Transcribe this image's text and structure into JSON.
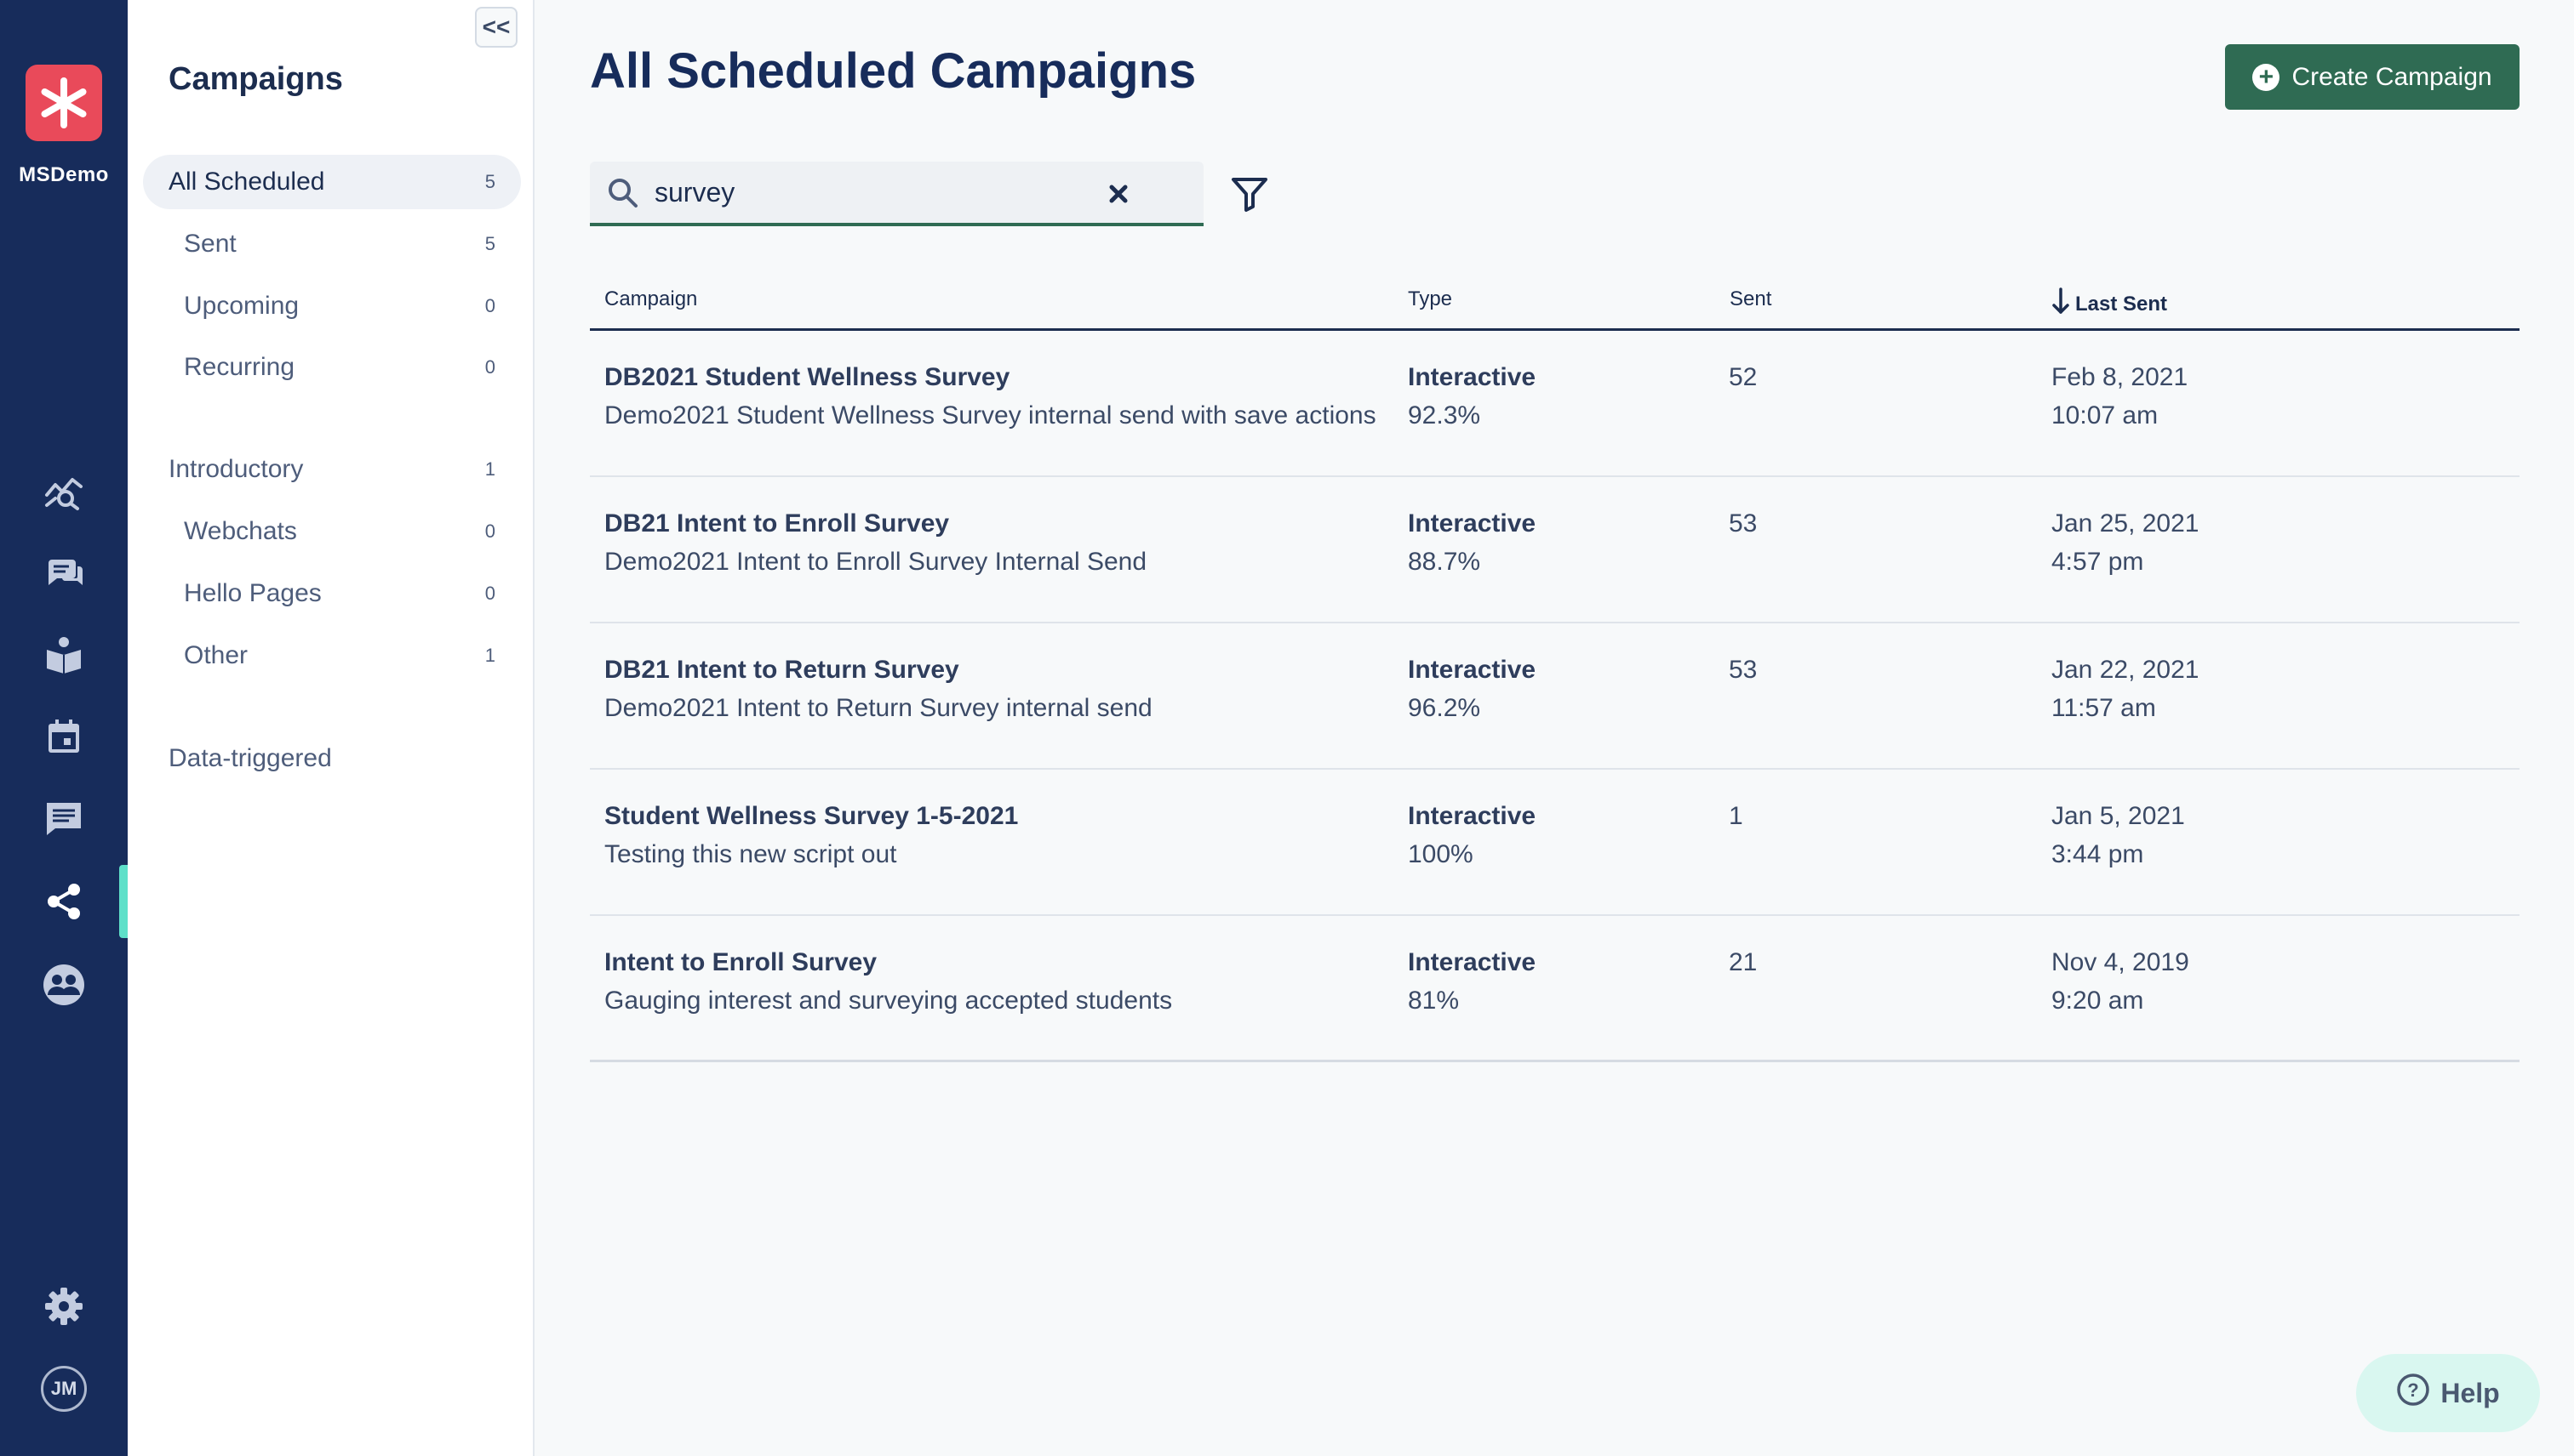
{
  "org": {
    "name": "MSDemo",
    "avatar_initials": "JM"
  },
  "rail": {
    "icons": [
      "analytics-icon",
      "chat-bubbles-icon",
      "book-icon",
      "calendar-icon",
      "message-icon",
      "share-network-icon",
      "people-icon",
      "gear-icon"
    ],
    "active": "share-network-icon",
    "active_color": "#5ee0c9"
  },
  "sidebar": {
    "title": "Campaigns",
    "collapse_label": "<<",
    "groups": [
      {
        "label": "All Scheduled",
        "count": "5"
      },
      {
        "label": "Sent",
        "count": "5"
      },
      {
        "label": "Upcoming",
        "count": "0"
      },
      {
        "label": "Recurring",
        "count": "0"
      },
      {
        "label": "Introductory",
        "count": "1"
      },
      {
        "label": "Webchats",
        "count": "0"
      },
      {
        "label": "Hello Pages",
        "count": "0"
      },
      {
        "label": "Other",
        "count": "1"
      },
      {
        "label": "Data-triggered",
        "count": ""
      }
    ]
  },
  "main": {
    "title": "All Scheduled Campaigns",
    "create_button": "Create Campaign",
    "search": {
      "value": "survey",
      "placeholder": ""
    },
    "columns": [
      "Campaign",
      "Type",
      "Sent",
      "Last Sent"
    ],
    "sort_column": "Last Sent",
    "rows": [
      {
        "name": "DB2021 Student Wellness Survey",
        "description": "Demo2021 Student Wellness Survey internal send with save actions",
        "type": "Interactive",
        "rate": "92.3%",
        "sent": "52",
        "date": "Feb 8, 2021",
        "time": "10:07 am"
      },
      {
        "name": "DB21 Intent to Enroll Survey",
        "description": "Demo2021 Intent to Enroll Survey Internal Send",
        "type": "Interactive",
        "rate": "88.7%",
        "sent": "53",
        "date": "Jan 25, 2021",
        "time": "4:57 pm"
      },
      {
        "name": "DB21 Intent to Return Survey",
        "description": "Demo2021 Intent to Return Survey internal send",
        "type": "Interactive",
        "rate": "96.2%",
        "sent": "53",
        "date": "Jan 22, 2021",
        "time": "11:57 am"
      },
      {
        "name": "Student Wellness Survey 1-5-2021",
        "description": "Testing this new script out",
        "type": "Interactive",
        "rate": "100%",
        "sent": "1",
        "date": "Jan 5, 2021",
        "time": "3:44 pm"
      },
      {
        "name": "Intent to Enroll Survey",
        "description": "Gauging interest and surveying accepted students",
        "type": "Interactive",
        "rate": "81%",
        "sent": "21",
        "date": "Nov 4, 2019",
        "time": "9:20 am"
      }
    ]
  },
  "help": {
    "label": "Help"
  },
  "colors": {
    "rail": "#172c5b",
    "primary": "#2f6b53",
    "logo": "#e94a5a",
    "help_bg": "#d9f7f0"
  }
}
